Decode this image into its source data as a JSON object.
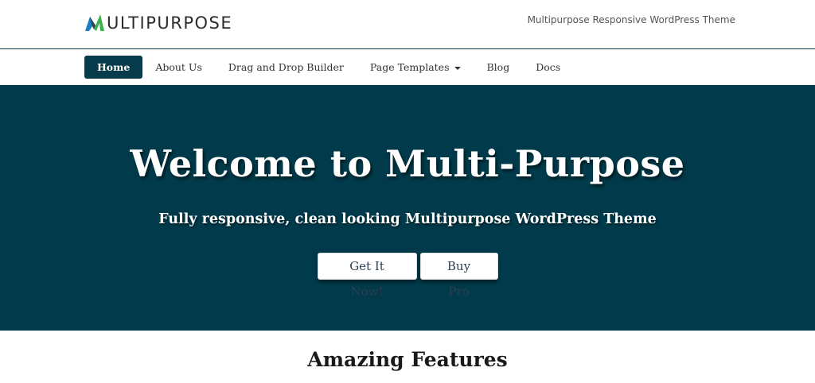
{
  "header": {
    "logo_text": "ULTIPURPOSE",
    "tagline": "Multipurpose Responsive WordPress Theme"
  },
  "nav": {
    "items": [
      {
        "label": "Home",
        "active": true
      },
      {
        "label": "About Us"
      },
      {
        "label": "Drag and Drop Builder"
      },
      {
        "label": "Page Templates",
        "has_dropdown": true
      },
      {
        "label": "Blog"
      },
      {
        "label": "Docs"
      }
    ]
  },
  "hero": {
    "title": "Welcome to Multi-Purpose",
    "subtitle": "Fully responsive, clean looking Multipurpose WordPress Theme",
    "primary_button": "Get It Now!",
    "secondary_button": "Buy Pro"
  },
  "features": {
    "title": "Amazing Features"
  },
  "colors": {
    "brand_dark": "#013a4a",
    "nav_active": "#073b4c",
    "logo_blue": "#1a7fc1",
    "logo_green": "#3bb34a"
  }
}
